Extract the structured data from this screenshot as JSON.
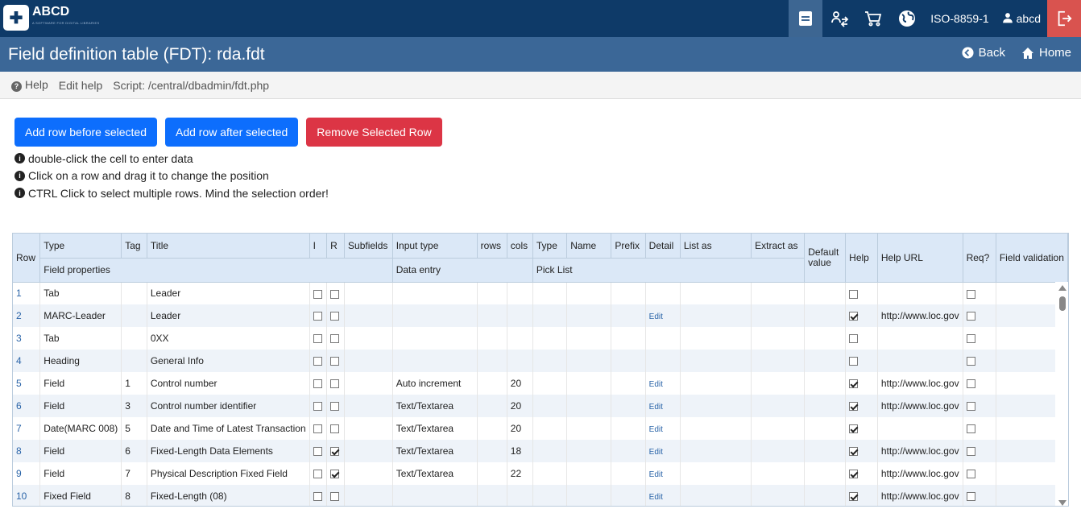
{
  "brand": {
    "name": "ABCD",
    "tagline": "A SOFTWARE FOR DIGITAL LIBRARIES"
  },
  "topbar": {
    "charset": "ISO-8859-1",
    "user": "abcd"
  },
  "titlebar": {
    "title": "Field definition table (FDT): rda.fdt",
    "back": "Back",
    "home": "Home"
  },
  "helpbar": {
    "help": "Help",
    "edit_help": "Edit help",
    "script": "Script: /central/dbadmin/fdt.php"
  },
  "buttons": {
    "add_before": "Add row before selected",
    "add_after": "Add row after selected",
    "remove": "Remove Selected Row"
  },
  "notes": [
    "double-click the cell to enter data",
    "Click on a row and drag it to change the position",
    "CTRL Click to select multiple rows. Mind the selection order!"
  ],
  "table": {
    "headers": {
      "row": "Row",
      "type": "Type",
      "tag": "Tag",
      "title": "Title",
      "i": "I",
      "r": "R",
      "subfields": "Subfields",
      "input_type": "Input type",
      "rows": "rows",
      "cols": "cols",
      "pl_type": "Type",
      "name": "Name",
      "prefix": "Prefix",
      "detail": "Detail",
      "list_as": "List as",
      "extract_as": "Extract as",
      "default_value": "Default value",
      "help": "Help",
      "help_url": "Help URL",
      "req": "Req?",
      "field_validation": "Field validation"
    },
    "groups": {
      "field_properties": "Field properties",
      "data_entry": "Data entry",
      "pick_list": "Pick List"
    },
    "edit_label": "Edit",
    "rows": [
      {
        "n": "1",
        "type": "Tab",
        "tag": "",
        "title": "Leader",
        "i": false,
        "r": false,
        "input": "",
        "cols": "",
        "edit": false,
        "help": false,
        "url": "",
        "req": false
      },
      {
        "n": "2",
        "type": "MARC-Leader",
        "tag": "",
        "title": "Leader",
        "i": false,
        "r": false,
        "input": "",
        "cols": "",
        "edit": true,
        "help": true,
        "url": "http://www.loc.gov",
        "req": false
      },
      {
        "n": "3",
        "type": "Tab",
        "tag": "",
        "title": "0XX",
        "i": false,
        "r": false,
        "input": "",
        "cols": "",
        "edit": false,
        "help": false,
        "url": "",
        "req": false
      },
      {
        "n": "4",
        "type": "Heading",
        "tag": "",
        "title": "General Info",
        "i": false,
        "r": false,
        "input": "",
        "cols": "",
        "edit": false,
        "help": false,
        "url": "",
        "req": false
      },
      {
        "n": "5",
        "type": "Field",
        "tag": "1",
        "title": "Control number",
        "i": false,
        "r": false,
        "input": "Auto increment",
        "cols": "20",
        "edit": true,
        "help": true,
        "url": "http://www.loc.gov",
        "req": false
      },
      {
        "n": "6",
        "type": "Field",
        "tag": "3",
        "title": "Control number identifier",
        "i": false,
        "r": false,
        "input": "Text/Textarea",
        "cols": "20",
        "edit": true,
        "help": true,
        "url": "http://www.loc.gov",
        "req": false
      },
      {
        "n": "7",
        "type": "Date(MARC 008)",
        "tag": "5",
        "title": "Date and Time of Latest Transaction",
        "i": false,
        "r": false,
        "input": "Text/Textarea",
        "cols": "20",
        "edit": true,
        "help": true,
        "url": "",
        "req": false
      },
      {
        "n": "8",
        "type": "Field",
        "tag": "6",
        "title": "Fixed-Length Data Elements",
        "i": false,
        "r": true,
        "input": "Text/Textarea",
        "cols": "18",
        "edit": true,
        "help": true,
        "url": "http://www.loc.gov",
        "req": false
      },
      {
        "n": "9",
        "type": "Field",
        "tag": "7",
        "title": "Physical Description Fixed Field",
        "i": false,
        "r": true,
        "input": "Text/Textarea",
        "cols": "22",
        "edit": true,
        "help": true,
        "url": "http://www.loc.gov",
        "req": false
      },
      {
        "n": "10",
        "type": "Fixed Field",
        "tag": "8",
        "title": "Fixed-Length (08)",
        "i": false,
        "r": false,
        "input": "",
        "cols": "",
        "edit": true,
        "help": true,
        "url": "http://www.loc.gov",
        "req": false
      }
    ]
  }
}
